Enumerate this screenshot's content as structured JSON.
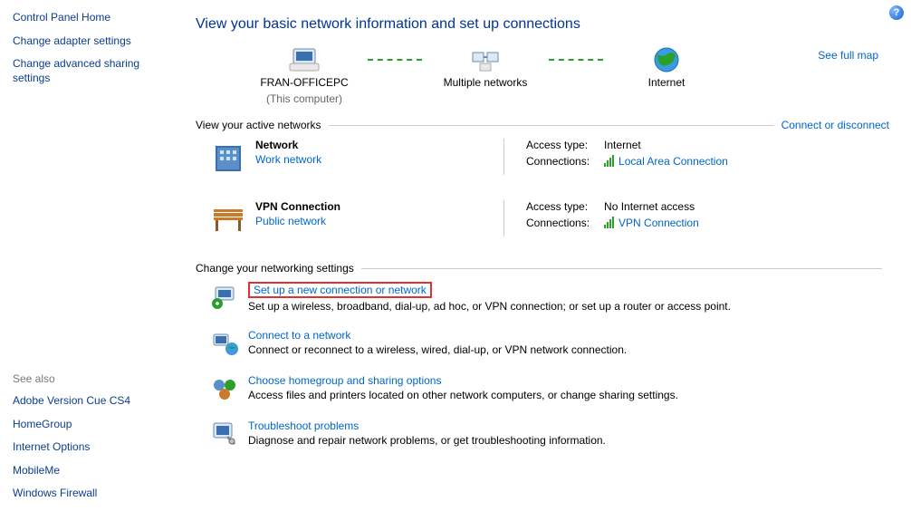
{
  "help": "?",
  "sidebar": {
    "top": [
      {
        "label": "Control Panel Home"
      },
      {
        "label": "Change adapter settings"
      },
      {
        "label": "Change advanced sharing settings"
      }
    ],
    "see_also_label": "See also",
    "bottom": [
      {
        "label": "Adobe Version Cue CS4"
      },
      {
        "label": "HomeGroup"
      },
      {
        "label": "Internet Options"
      },
      {
        "label": "MobileMe"
      },
      {
        "label": "Windows Firewall"
      }
    ]
  },
  "page_title": "View your basic network information and set up connections",
  "map": {
    "full_map": "See full map",
    "nodes": [
      {
        "name": "FRAN-OFFICEPC",
        "sub": "(This computer)"
      },
      {
        "name": "Multiple networks",
        "sub": ""
      },
      {
        "name": "Internet",
        "sub": ""
      }
    ]
  },
  "active_networks": {
    "header": "View your active networks",
    "action": "Connect or disconnect",
    "items": [
      {
        "name": "Network",
        "type": "Work network",
        "access_label": "Access type:",
        "access_value": "Internet",
        "conn_label": "Connections:",
        "conn_value": "Local Area Connection"
      },
      {
        "name": "VPN Connection",
        "type": "Public network",
        "access_label": "Access type:",
        "access_value": "No Internet access",
        "conn_label": "Connections:",
        "conn_value": "VPN Connection"
      }
    ]
  },
  "settings": {
    "header": "Change your networking settings",
    "items": [
      {
        "title": "Set up a new connection or network",
        "desc": "Set up a wireless, broadband, dial-up, ad hoc, or VPN connection; or set up a router or access point.",
        "highlight": true
      },
      {
        "title": "Connect to a network",
        "desc": "Connect or reconnect to a wireless, wired, dial-up, or VPN network connection."
      },
      {
        "title": "Choose homegroup and sharing options",
        "desc": "Access files and printers located on other network computers, or change sharing settings."
      },
      {
        "title": "Troubleshoot problems",
        "desc": "Diagnose and repair network problems, or get troubleshooting information."
      }
    ]
  }
}
